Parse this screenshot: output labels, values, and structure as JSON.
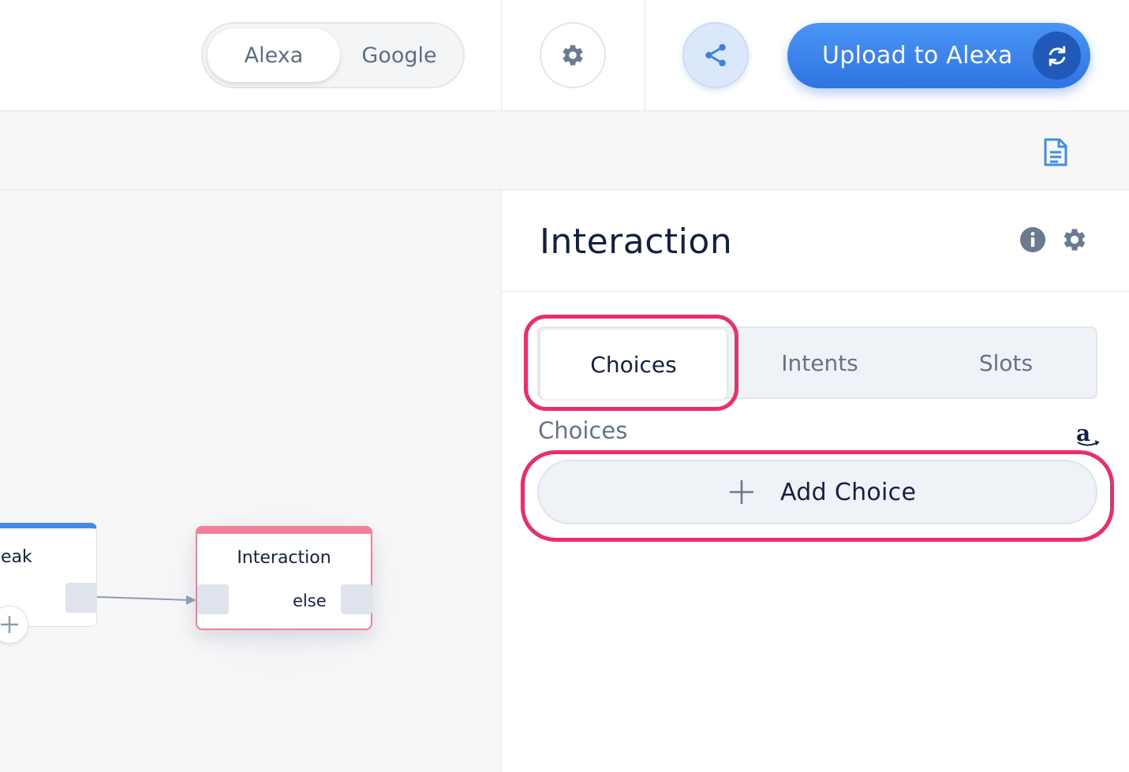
{
  "topbar": {
    "platform_options": [
      "Alexa",
      "Google"
    ],
    "active_platform": "Alexa",
    "settings_icon": "gear-icon",
    "share_icon": "share-icon",
    "upload_label": "Upload to Alexa",
    "upload_icon": "refresh-icon"
  },
  "subbar": {
    "doc_icon": "document-icon"
  },
  "canvas": {
    "speak_node_title": "eak",
    "interaction_node": {
      "title": "Interaction",
      "else_label": "else"
    }
  },
  "panel": {
    "title": "Interaction",
    "tabs": [
      {
        "label": "Choices",
        "active": true
      },
      {
        "label": "Intents",
        "active": false
      },
      {
        "label": "Slots",
        "active": false
      }
    ],
    "section_label": "Choices",
    "amazon_badge": "a",
    "add_choice_label": "Add Choice"
  },
  "colors": {
    "accent_blue": "#2f74e3",
    "highlight_pink": "#ef2b6a",
    "node_pink": "#f37e95",
    "node_blue": "#3f8de9",
    "text_dark": "#132042",
    "text_muted": "#62738a"
  }
}
